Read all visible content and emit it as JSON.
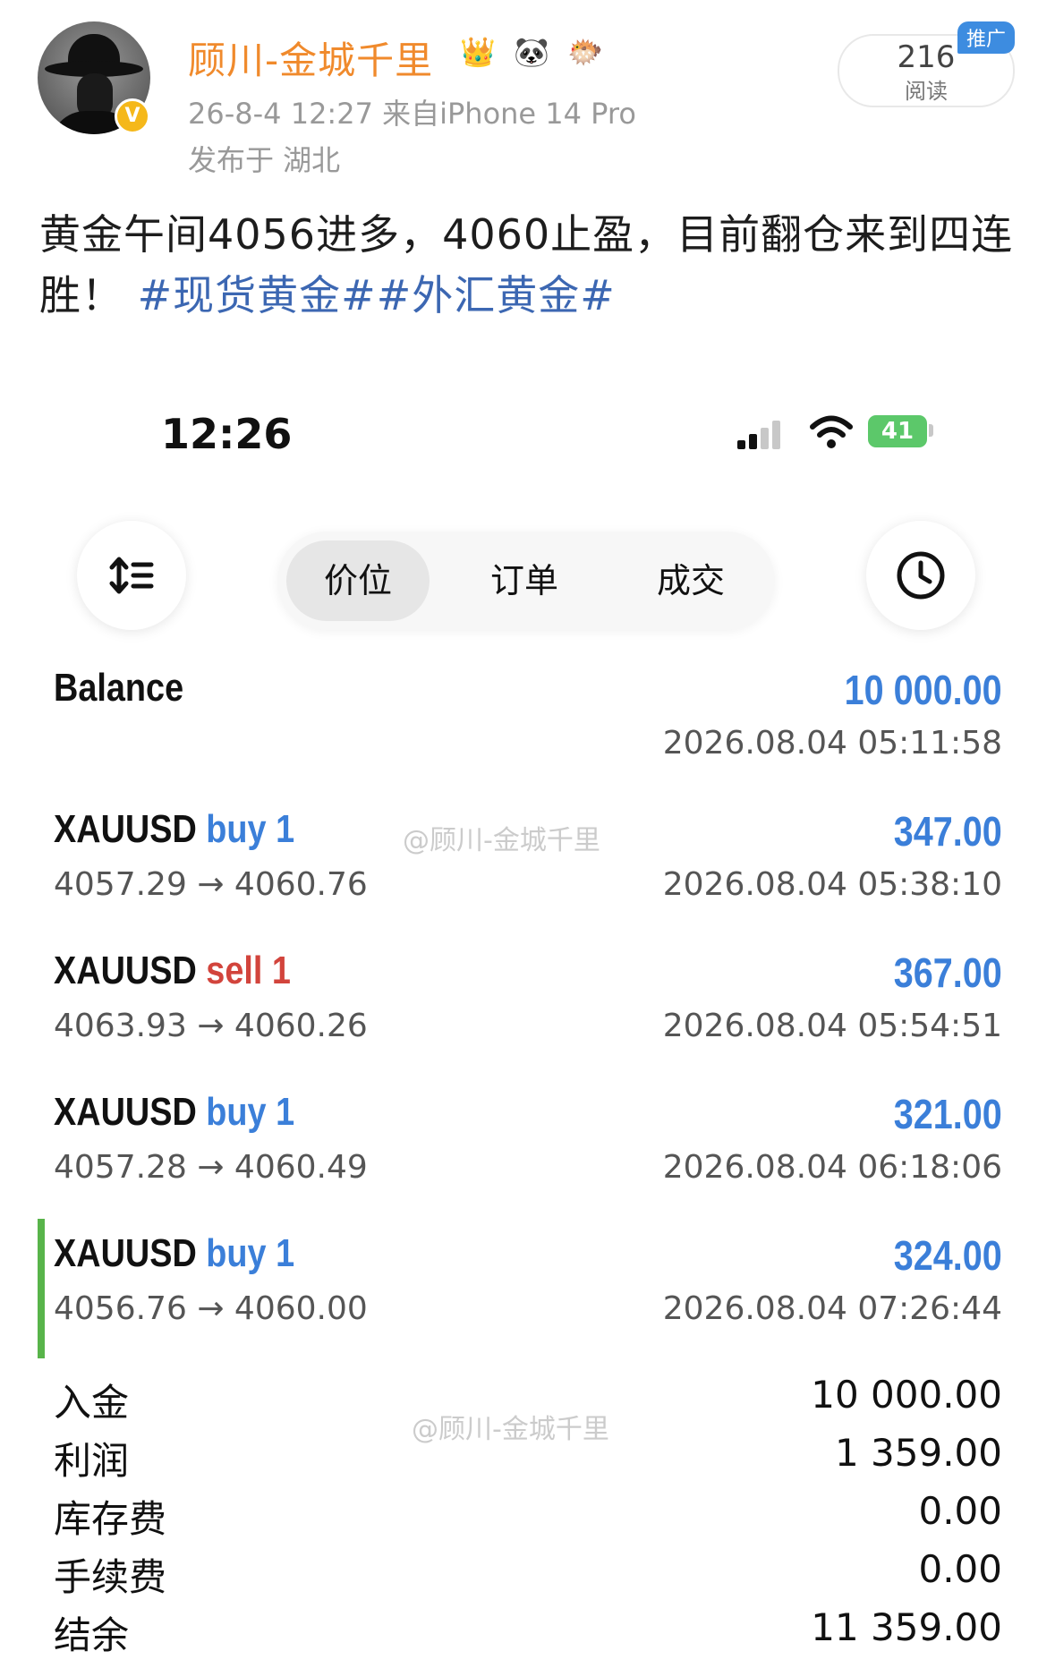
{
  "post": {
    "username": "顾川-金城千里",
    "badges": [
      {
        "name": "crown-badge-icon",
        "glyph": "👑"
      },
      {
        "name": "panda-badge-icon",
        "glyph": "🐼"
      },
      {
        "name": "fish-badge-icon",
        "glyph": "🐡"
      }
    ],
    "verified_glyph": "V",
    "meta": "26-8-4 12:27  来自iPhone 14 Pro",
    "location": "发布于 湖北",
    "read_count": "216",
    "read_label": "阅读",
    "promo_tag": "推广",
    "text_main": "黄金午间4056进多，4060止盈，目前翻仓来到四连胜！",
    "hashtags": "#现货黄金##外汇黄金#",
    "colors": {
      "username": "#f08a2c",
      "hashtag": "#3c67b2",
      "verified": "#f5b81a",
      "promo": "#3d8ce0"
    }
  },
  "screenshot": {
    "status_time": "12:26",
    "battery": "41",
    "icons": [
      "sort-icon",
      "clock-icon",
      "signal-icon",
      "wifi-icon",
      "battery-icon"
    ],
    "tabs": [
      {
        "label": "价位",
        "active": true
      },
      {
        "label": "订单",
        "active": false
      },
      {
        "label": "成交",
        "active": false
      }
    ],
    "balance": {
      "label": "Balance",
      "amount": "10 000.00",
      "time": "2026.08.04 05:11:58"
    },
    "trades": [
      {
        "symbol": "XAUUSD",
        "side": "buy 1",
        "prices": "4057.29 → 4060.76",
        "amount": "347.00",
        "time": "2026.08.04 05:38:10"
      },
      {
        "symbol": "XAUUSD",
        "side": "sell 1",
        "prices": "4063.93 → 4060.26",
        "amount": "367.00",
        "time": "2026.08.04 05:54:51"
      },
      {
        "symbol": "XAUUSD",
        "side": "buy 1",
        "prices": "4057.28 → 4060.49",
        "amount": "321.00",
        "time": "2026.08.04 06:18:06"
      },
      {
        "symbol": "XAUUSD",
        "side": "buy 1",
        "prices": "4056.76 → 4060.00",
        "amount": "324.00",
        "time": "2026.08.04 07:26:44",
        "highlighted": true
      }
    ],
    "summary": [
      {
        "label": "入金",
        "value": "10 000.00"
      },
      {
        "label": "利润",
        "value": "1 359.00"
      },
      {
        "label": "库存费",
        "value": "0.00"
      },
      {
        "label": "手续费",
        "value": "0.00"
      },
      {
        "label": "结余",
        "value": "11 359.00"
      }
    ],
    "watermark": "@顾川-金城千里",
    "colors": {
      "buy": "#3b7fd9",
      "sell": "#d2443c",
      "highlight_bar": "#58b44a",
      "battery": "#5cc86a"
    }
  }
}
